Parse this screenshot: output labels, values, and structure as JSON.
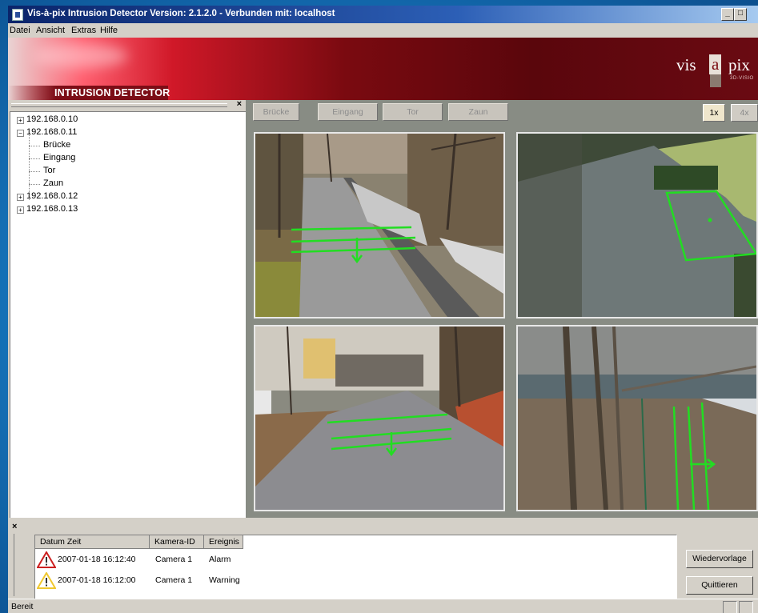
{
  "window": {
    "title": "Vis-à-pix Intrusion Detector Version: 2.1.2.0 - Verbunden mit: localhost",
    "minimize_label": "_",
    "maximize_label": "□"
  },
  "menu": [
    "Datei",
    "Ansicht",
    "Extras",
    "Hilfe"
  ],
  "banner": {
    "product_name": "INTRUSION DETECTOR",
    "logo_left": "vis",
    "logo_mid": "a",
    "logo_right": "pix",
    "logo_sub": "3D-VISIO"
  },
  "tree": {
    "close_label": "×",
    "hosts": [
      {
        "label": "192.168.0.10",
        "expanded": false,
        "expander": "+"
      },
      {
        "label": "192.168.0.11",
        "expanded": true,
        "expander": "−",
        "cameras": [
          "Brücke",
          "Eingang",
          "Tor",
          "Zaun"
        ]
      },
      {
        "label": "192.168.0.12",
        "expanded": false,
        "expander": "+"
      },
      {
        "label": "192.168.0.13",
        "expanded": false,
        "expander": "+"
      }
    ]
  },
  "camera_toolbar": {
    "buttons": [
      "Brücke",
      "Eingang",
      "Tor",
      "Zaun"
    ],
    "zoom_1x": "1x",
    "zoom_4x": "4x"
  },
  "events": {
    "close_label": "×",
    "columns": [
      "Datum Zeit",
      "Kamera-ID",
      "Ereignis"
    ],
    "rows": [
      {
        "datetime": "2007-01-18 16:12:40",
        "camera": "Camera 1",
        "event": "Alarm",
        "severity": "alarm"
      },
      {
        "datetime": "2007-01-18 16:12:00",
        "camera": "Camera 1",
        "event": "Warning",
        "severity": "warning"
      }
    ],
    "recall_button": "Wiedervorlage",
    "ack_button": "Quittieren"
  },
  "status": {
    "text": "Bereit"
  },
  "colors": {
    "overlay_green": "#22dd22",
    "banner_red": "#7a0a10",
    "alarm_red": "#cc2020",
    "warning_yellow": "#f0c830"
  }
}
